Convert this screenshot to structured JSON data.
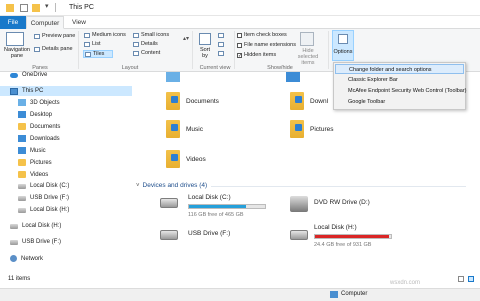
{
  "window": {
    "title": "This PC"
  },
  "tabs": [
    {
      "label": "File"
    },
    {
      "label": "Computer"
    },
    {
      "label": "View"
    }
  ],
  "ribbon": {
    "panes": {
      "navigation_pane": "Navigation\npane",
      "preview_pane": "Preview pane",
      "details_pane": "Details pane",
      "label": "Panes"
    },
    "layout": {
      "medium_icons": "Medium icons",
      "small_icons": "Small icons",
      "list": "List",
      "details": "Details",
      "tiles": "Tiles",
      "content": "Content",
      "label": "Layout"
    },
    "current_view": {
      "sort_by": "Sort\nby",
      "label": "Current view"
    },
    "show_hide": {
      "item_check_boxes": "Item check boxes",
      "file_name_extensions": "File name extensions",
      "hidden_items": "Hidden items",
      "hide_selected": "Hide selected\nitems",
      "label": "Show/hide"
    },
    "options": "Options"
  },
  "sidebar": {
    "items": [
      {
        "label": "OneDrive",
        "icon": "cloud-icon"
      },
      {
        "label": "This PC",
        "icon": "computer-icon"
      },
      {
        "label": "3D Objects",
        "icon": "folder-icon"
      },
      {
        "label": "Desktop",
        "icon": "folder-icon"
      },
      {
        "label": "Documents",
        "icon": "folder-icon"
      },
      {
        "label": "Downloads",
        "icon": "folder-icon"
      },
      {
        "label": "Music",
        "icon": "folder-icon"
      },
      {
        "label": "Pictures",
        "icon": "folder-icon"
      },
      {
        "label": "Videos",
        "icon": "folder-icon"
      },
      {
        "label": "Local Disk (C:)",
        "icon": "drive-icon"
      },
      {
        "label": "USB Drive (F:)",
        "icon": "drive-icon"
      },
      {
        "label": "Local Disk (H:)",
        "icon": "drive-icon"
      },
      {
        "label": "Local Disk (H:)",
        "icon": "drive-icon"
      },
      {
        "label": "USB Drive (F:)",
        "icon": "drive-icon"
      },
      {
        "label": "Network",
        "icon": "network-icon"
      }
    ]
  },
  "folders": [
    {
      "label": "Documents"
    },
    {
      "label": "Downl"
    },
    {
      "label": "Music"
    },
    {
      "label": "Pictures"
    },
    {
      "label": "Videos"
    }
  ],
  "devices": {
    "header": "Devices and drives (4)",
    "items": [
      {
        "name": "Local Disk (C:)",
        "sub": "116 GB free of 465 GB",
        "used": 0.75,
        "bar_color": "#26a0da"
      },
      {
        "name": "DVD RW Drive (D:)",
        "sub": ""
      },
      {
        "name": "USB Drive (F:)",
        "sub": ""
      },
      {
        "name": "Local Disk (H:)",
        "sub": "24.4 GB free of 931 GB",
        "used": 0.97,
        "bar_color": "#da2626"
      }
    ]
  },
  "options_menu": {
    "items": [
      {
        "label": "Change folder and search options"
      },
      {
        "label": "Classic Explorer Bar"
      },
      {
        "label": "McAfee Endpoint Security Web Control (Toolbar)"
      },
      {
        "label": "Google Toolbar"
      }
    ]
  },
  "status": {
    "items_count": "11 items"
  },
  "taskbar": {
    "computer_label": "Computer"
  },
  "watermark": "wsxdn.com"
}
